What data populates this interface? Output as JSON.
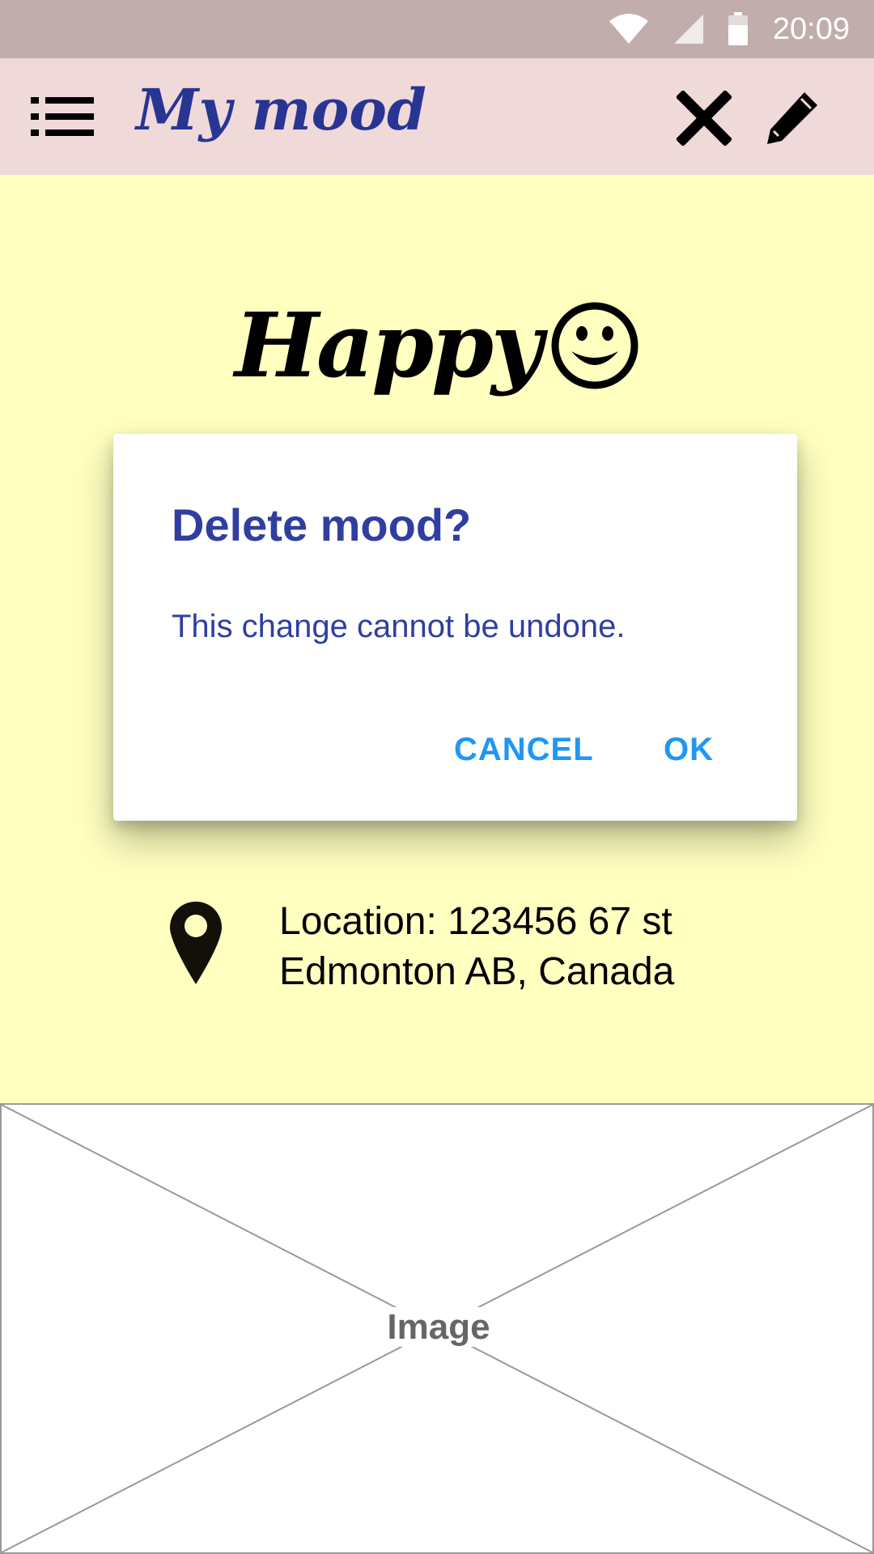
{
  "status_bar": {
    "time": "20:09",
    "icons": [
      "wifi-icon",
      "cell-signal-icon",
      "battery-icon"
    ]
  },
  "app_bar": {
    "title": "My mood",
    "icons": [
      "list-menu-icon",
      "close-icon",
      "pencil-icon"
    ]
  },
  "mood": {
    "label": "Happy",
    "emoji": "smiley-face-icon"
  },
  "details": {
    "location_line1": "Location: 123456 67 st",
    "location_line2": "Edmonton AB, Canada"
  },
  "image_placeholder": {
    "label": "Image"
  },
  "dialog": {
    "title": "Delete mood?",
    "message": "This change cannot be undone.",
    "cancel_label": "CANCEL",
    "ok_label": "OK"
  },
  "colors": {
    "background": "#ffffc0",
    "status_bar": "#c2adad",
    "app_bar": "#f0d9d9",
    "title": "#283593",
    "dialog_text": "#303f9f",
    "dialog_button": "#2196f3"
  }
}
